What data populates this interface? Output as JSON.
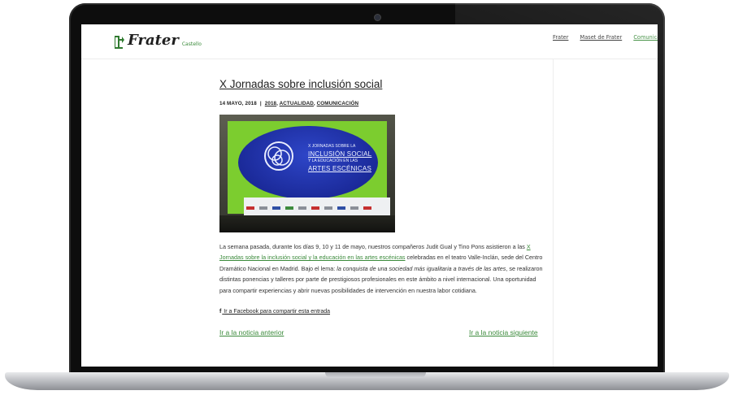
{
  "site": {
    "logo_name": "Frater",
    "logo_sub": "Castello",
    "nav": [
      "Frater",
      "Maset de Frater",
      "Comunica"
    ]
  },
  "post": {
    "title": "X Jornadas sobre inclusión social",
    "date": "14 MAYO, 2018",
    "separator": "|",
    "categories": [
      "2018",
      "ACTUALIDAD",
      "COMUNICACIÓN"
    ],
    "body": {
      "p1": "La semana pasada, durante los días 9, 10 y 11 de mayo, nuestros compañeros Judit Gual y Tino Pons asistieron a las ",
      "link": "X Jornadas sobre la inclusión social y la educación en las artes escénicas",
      "p2": " celebradas en el teatro Valle-Inclán, sede del Centro Dramático Nacional en Madrid. Bajo el lema: ",
      "motto": "la conquista de una sociedad más igualitaria a través de las artes",
      "p3": ", se realizaron distintas ponencias y talleres por parte de prestigiosos profesionales en este ámbito a nivel internacional. Una oportunidad para compartir experiencias y abrir nuevas posibilidades de intervención en nuestra labor cotidiana."
    },
    "share_text": "Ir a Facebook para compartir esta entrada",
    "prev_label": "Ir a la noticia anterior",
    "next_label": "Ir a la noticia siguiente"
  },
  "photo": {
    "line1": "X JORNADAS SOBRE LA",
    "line2": "INCLUSIÓN SOCIAL",
    "line3": "Y LA EDUCACIÓN EN LAS",
    "line4": "ARTES ESCÉNICAS"
  },
  "colors": {
    "accent_green": "#3a8a3a",
    "projection_green": "#7ccd2f",
    "projection_blue": "#1b2a9a"
  },
  "icons": {
    "facebook": "facebook-icon",
    "logo": "tree-logo-icon",
    "camera": "webcam-icon"
  }
}
